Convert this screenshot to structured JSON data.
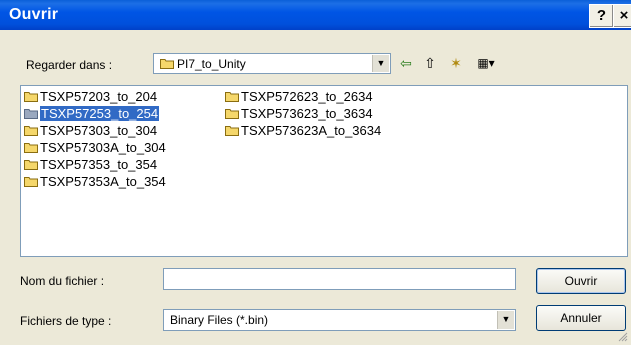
{
  "window": {
    "title": "Ouvrir",
    "help_label": "?",
    "close_label": "×"
  },
  "look_in": {
    "label": "Regarder dans :",
    "value": "PI7_to_Unity"
  },
  "toolbar": {
    "back_glyph": "⇦",
    "up_glyph": "⇧",
    "new_folder_glyph": "✶",
    "view_glyph": "▦▾"
  },
  "files": [
    {
      "name": "TSXP57203_to_204",
      "selected": false
    },
    {
      "name": "TSXP57253_to_254",
      "selected": true
    },
    {
      "name": "TSXP57303_to_304",
      "selected": false
    },
    {
      "name": "TSXP57303A_to_304",
      "selected": false
    },
    {
      "name": "TSXP57353_to_354",
      "selected": false
    },
    {
      "name": "TSXP57353A_to_354",
      "selected": false
    },
    {
      "name": "TSXP572623_to_2634",
      "selected": false
    },
    {
      "name": "TSXP573623_to_3634",
      "selected": false
    },
    {
      "name": "TSXP573623A_to_3634",
      "selected": false
    }
  ],
  "filename": {
    "label": "Nom du fichier :",
    "value": ""
  },
  "filetype": {
    "label": "Fichiers de type :",
    "value": "Binary Files (*.bin)"
  },
  "buttons": {
    "open": "Ouvrir",
    "cancel": "Annuler"
  },
  "colors": {
    "titlebar": "#0055e5",
    "selection": "#316ac5",
    "dialog_bg": "#ece9d8",
    "folder": "#f5d76b"
  }
}
